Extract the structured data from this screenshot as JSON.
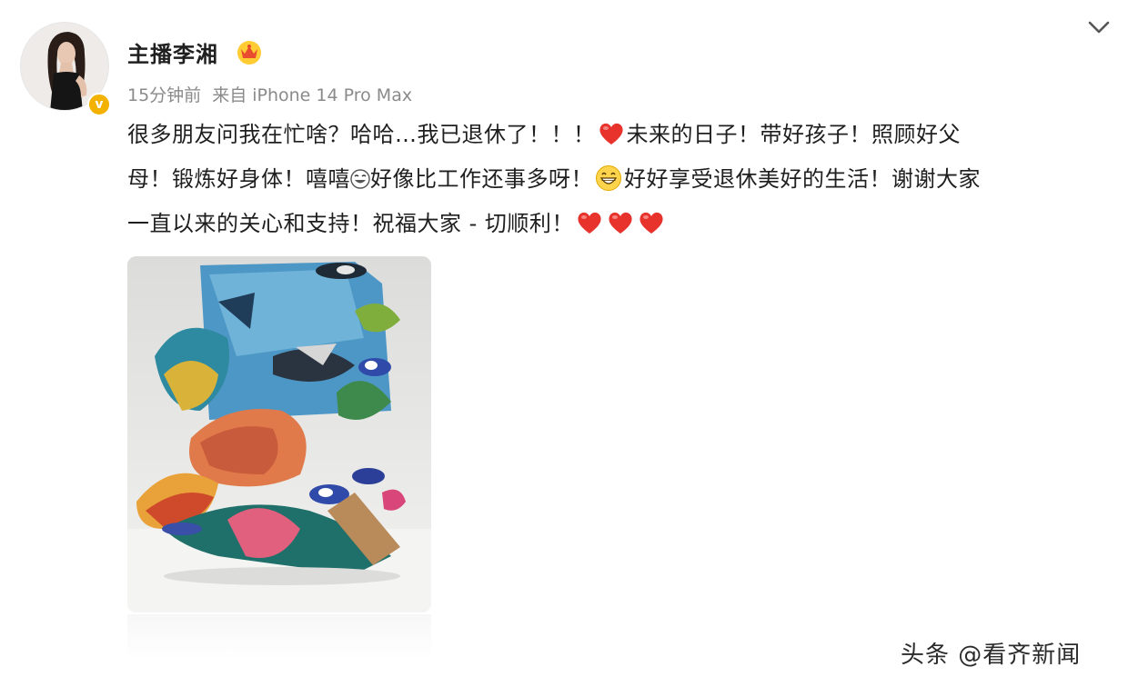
{
  "post": {
    "username": "主播李湘",
    "time": "15分钟前",
    "source": "来自 iPhone 14 Pro Max",
    "content": {
      "seg1": "很多朋友问我在忙啥？哈哈…我已退休了！！！",
      "seg2": "未来的日子！带好孩子！照顾好父",
      "seg3": "母！锻炼好身体！嘻嘻",
      "seg4": "好像比工作还事多呀！",
      "seg5": "好好享受退休美好的生活！谢谢大家",
      "seg6": "一直以来的关心和支持！祝福大家 - 切顺利！"
    }
  },
  "watermark": "头条 @看齐新闻",
  "icons": {
    "menu": "chevron-down-icon",
    "badge": "verified-badge-icon",
    "crown": "crown-icon",
    "heart": "heart-icon",
    "grin": "grin-face-icon",
    "laugh": "laugh-face-icon"
  },
  "colors": {
    "heart": "#e8332d",
    "badge": "#f3b100",
    "meta": "#8a8a8a",
    "text": "#1f1f1f"
  }
}
